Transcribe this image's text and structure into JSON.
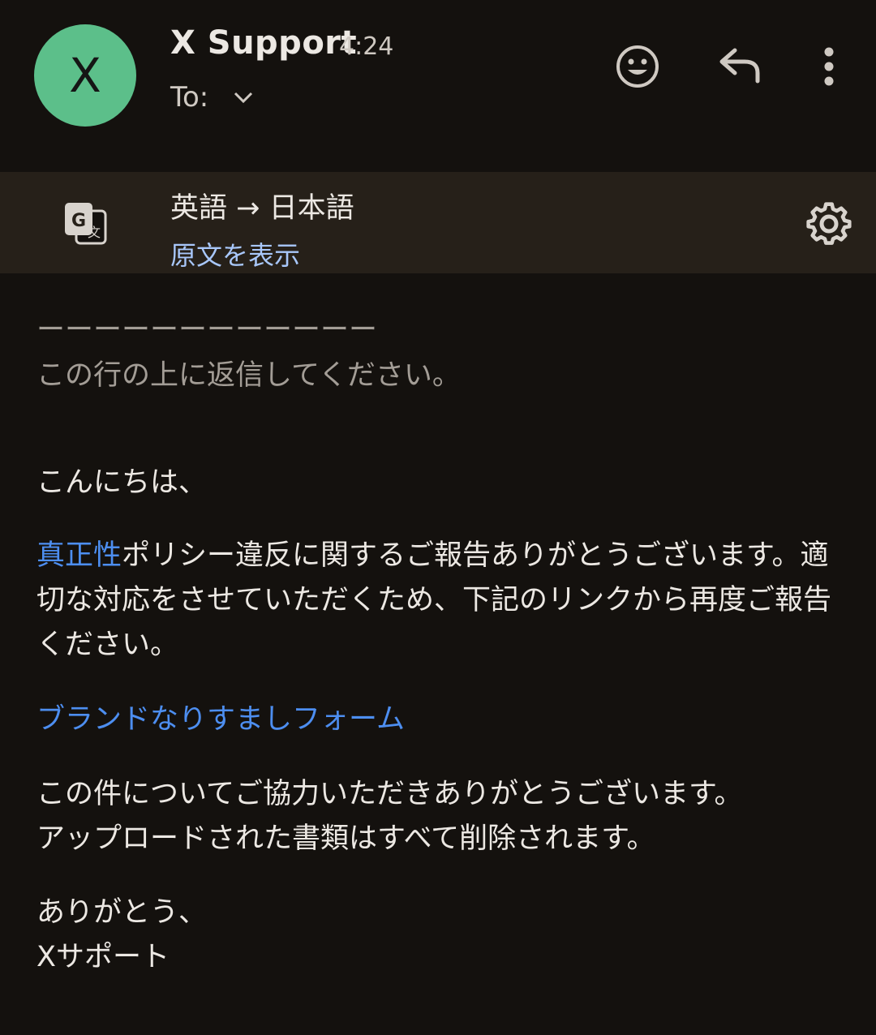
{
  "header": {
    "avatar_letter": "X",
    "sender": "X Support",
    "time": "4:24",
    "to_label": "To:"
  },
  "translate": {
    "languages": "英語 → 日本語",
    "show_original": "原文を表示"
  },
  "body": {
    "divider": "ーーーーーーーーーーーー",
    "reply_above": "この行の上に返信してください。",
    "greeting": "こんにちは、",
    "p1_link": "真正性",
    "p1_text": "ポリシー違反に関するご報告ありがとうございます。適切な対応をさせていただくため、下記のリンクから再度ご報告ください。",
    "form_link": "ブランドなりすましフォーム",
    "p2_line1": "この件についてご協力いただきありがとうございます。",
    "p2_line2": "アップロードされた書類はすべて削除されます。",
    "sign_line1": "ありがとう、",
    "sign_line2": "Xサポート"
  },
  "colors": {
    "background": "#14110e",
    "avatar": "#5cbf8a",
    "link": "#4d8ef0",
    "translate_bar": "#262019"
  }
}
